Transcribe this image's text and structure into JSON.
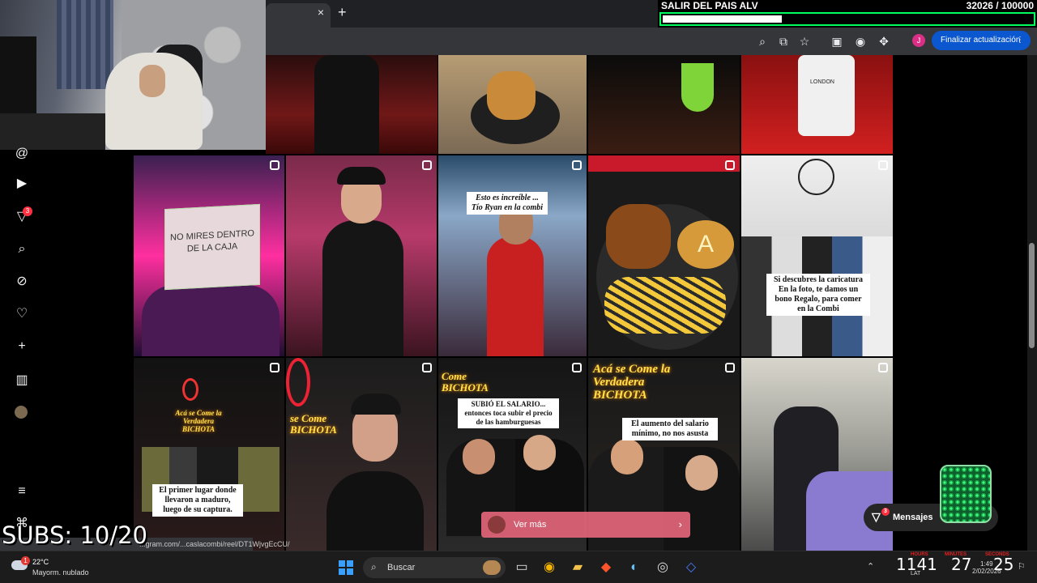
{
  "goal": {
    "title": "SALIR DEL PAIS ALV",
    "count": "32026 / 100000",
    "progress": 0.3203,
    "border_color": "#00ff5e"
  },
  "browser": {
    "tab_close": "×",
    "new_tab": "+",
    "update_button": "Finalizar actualización",
    "menu_dots": "⋮",
    "profile_initial": "J"
  },
  "sidebar": {
    "items": [
      {
        "icon": "threads-icon",
        "glyph": "@"
      },
      {
        "icon": "reels-icon",
        "glyph": "▶"
      },
      {
        "icon": "direct-icon",
        "glyph": "▽",
        "badge": "3"
      },
      {
        "icon": "search-icon",
        "glyph": "⌕"
      },
      {
        "icon": "explore-icon",
        "glyph": "⊘"
      },
      {
        "icon": "heart-icon",
        "glyph": "♡"
      },
      {
        "icon": "create-icon",
        "glyph": "+"
      },
      {
        "icon": "insights-icon",
        "glyph": "▥"
      },
      {
        "icon": "profile-avatar",
        "glyph": ""
      },
      {
        "icon": "menu-icon",
        "glyph": "≡"
      },
      {
        "icon": "meta-icon",
        "glyph": "⌘"
      }
    ]
  },
  "tiles": {
    "sign": "NO MIRES DENTRO DE LA CAJA",
    "caption_tio": "Esto es increíble ... Tío Ryan en la combi",
    "caption_caricatura": "Si descubres la caricatura En la foto, te damos un bono Regalo, para comer en la Combi",
    "caption_maduro": "El primer lugar donde llevaron a maduro, luego de su captura.",
    "caption_salario": "SUBIÓ EL SALARIO... entonces toca subir el precio de las hamburguesas",
    "caption_aumento": "El aumento del salario mínimo, no nos asusta",
    "neon_1": "Acá se Come la Verdadera BICHOTA",
    "neon_2": "se Come BICHOTA",
    "neon_3": "Come BICHOTA",
    "neon_4": "Acá se Come la Verdadera BICHOTA",
    "shirt_text": "LONDON"
  },
  "vermas": {
    "label": "Ver más",
    "chevron": "›"
  },
  "messages": {
    "label": "Mensajes",
    "badge": "3"
  },
  "overlay": {
    "subs": "SUBS: 10/20",
    "url": "...gram.com/...caslacombi/reel/DT1WjvgEcCU/"
  },
  "taskbar": {
    "temp": "22°C",
    "weather": "Mayorm. nublado",
    "weather_badge": "1",
    "search_label": "Buscar",
    "clock_hours": "1141",
    "clock_minutes": "27",
    "clock_seconds": "25",
    "label_hours": "HOURS",
    "label_minutes": "MINUTES",
    "label_seconds": "SECONDS",
    "time_small": "1:49",
    "date_small": "2/02/2026",
    "lang": "LAT"
  }
}
